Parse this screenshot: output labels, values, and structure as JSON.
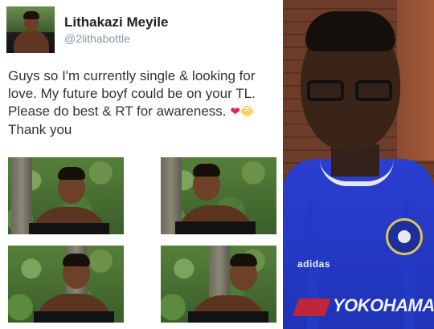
{
  "tweet": {
    "author_name": "Lithakazi Meyile",
    "handle": "@2lithabottle",
    "text_lines": [
      "Guys so I'm currently single & looking for",
      "love. My future boyf could be on your TL.",
      "Please do best & RT for awareness."
    ],
    "last_line": "Thank you",
    "emojis": [
      "heart-icon",
      "tears-of-joy-icon"
    ],
    "photo_count": 4
  },
  "selfie": {
    "jersey_brand_text": "adidas",
    "sponsor_text": "YOKOHAMA TYR",
    "jersey_color": "#2a3fd0"
  },
  "colors": {
    "name": "#222222",
    "handle": "#8899a6",
    "text": "#333333",
    "heart": "#e0245e"
  }
}
